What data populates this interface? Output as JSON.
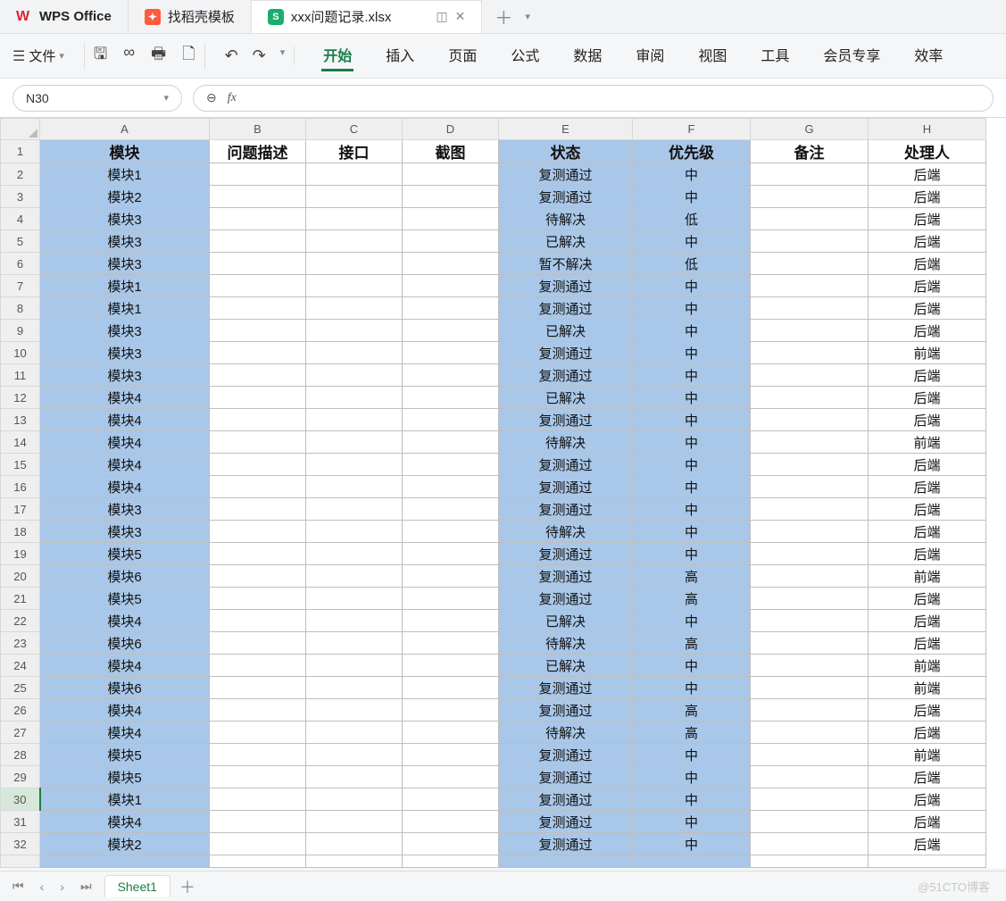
{
  "app": {
    "name": "WPS Office",
    "templates_tab": "找稻壳模板",
    "doc_tab": "xxx问题记录.xlsx"
  },
  "ribbon": {
    "file_label": "文件",
    "tabs": [
      "开始",
      "插入",
      "页面",
      "公式",
      "数据",
      "审阅",
      "视图",
      "工具",
      "会员专享",
      "效率"
    ],
    "active_tab_index": 0
  },
  "formula": {
    "namebox": "N30",
    "fx_label": "fx",
    "value": ""
  },
  "columns": [
    {
      "letter": "A",
      "width": 190
    },
    {
      "letter": "B",
      "width": 108
    },
    {
      "letter": "C",
      "width": 108
    },
    {
      "letter": "D",
      "width": 108
    },
    {
      "letter": "E",
      "width": 150
    },
    {
      "letter": "F",
      "width": 132
    },
    {
      "letter": "G",
      "width": 132
    },
    {
      "letter": "H",
      "width": 132
    }
  ],
  "headers": [
    "模块",
    "问题描述",
    "接口",
    "截图",
    "状态",
    "优先级",
    "备注",
    "处理人"
  ],
  "selected_cols": [
    0,
    4,
    5
  ],
  "rows": [
    {
      "n": 2,
      "a": "模块1",
      "e": "复测通过",
      "f": "中",
      "h": "后端"
    },
    {
      "n": 3,
      "a": "模块2",
      "e": "复测通过",
      "f": "中",
      "h": "后端"
    },
    {
      "n": 4,
      "a": "模块3",
      "e": "待解决",
      "f": "低",
      "h": "后端"
    },
    {
      "n": 5,
      "a": "模块3",
      "e": "已解决",
      "f": "中",
      "h": "后端"
    },
    {
      "n": 6,
      "a": "模块3",
      "e": "暂不解决",
      "f": "低",
      "h": "后端"
    },
    {
      "n": 7,
      "a": "模块1",
      "e": "复测通过",
      "f": "中",
      "h": "后端"
    },
    {
      "n": 8,
      "a": "模块1",
      "e": "复测通过",
      "f": "中",
      "h": "后端"
    },
    {
      "n": 9,
      "a": "模块3",
      "e": "已解决",
      "f": "中",
      "h": "后端"
    },
    {
      "n": 10,
      "a": "模块3",
      "e": "复测通过",
      "f": "中",
      "h": "前端"
    },
    {
      "n": 11,
      "a": "模块3",
      "e": "复测通过",
      "f": "中",
      "h": "后端"
    },
    {
      "n": 12,
      "a": "模块4",
      "e": "已解决",
      "f": "中",
      "h": "后端"
    },
    {
      "n": 13,
      "a": "模块4",
      "e": "复测通过",
      "f": "中",
      "h": "后端"
    },
    {
      "n": 14,
      "a": "模块4",
      "e": "待解决",
      "f": "中",
      "h": "前端"
    },
    {
      "n": 15,
      "a": "模块4",
      "e": "复测通过",
      "f": "中",
      "h": "后端"
    },
    {
      "n": 16,
      "a": "模块4",
      "e": "复测通过",
      "f": "中",
      "h": "后端"
    },
    {
      "n": 17,
      "a": "模块3",
      "e": "复测通过",
      "f": "中",
      "h": "后端"
    },
    {
      "n": 18,
      "a": "模块3",
      "e": "待解决",
      "f": "中",
      "h": "后端"
    },
    {
      "n": 19,
      "a": "模块5",
      "e": "复测通过",
      "f": "中",
      "h": "后端"
    },
    {
      "n": 20,
      "a": "模块6",
      "e": "复测通过",
      "f": "高",
      "h": "前端"
    },
    {
      "n": 21,
      "a": "模块5",
      "e": "复测通过",
      "f": "高",
      "h": "后端"
    },
    {
      "n": 22,
      "a": "模块4",
      "e": "已解决",
      "f": "中",
      "h": "后端"
    },
    {
      "n": 23,
      "a": "模块6",
      "e": "待解决",
      "f": "高",
      "h": "后端"
    },
    {
      "n": 24,
      "a": "模块4",
      "e": "已解决",
      "f": "中",
      "h": "前端"
    },
    {
      "n": 25,
      "a": "模块6",
      "e": "复测通过",
      "f": "中",
      "h": "前端"
    },
    {
      "n": 26,
      "a": "模块4",
      "e": "复测通过",
      "f": "高",
      "h": "后端"
    },
    {
      "n": 27,
      "a": "模块4",
      "e": "待解决",
      "f": "高",
      "h": "后端"
    },
    {
      "n": 28,
      "a": "模块5",
      "e": "复测通过",
      "f": "中",
      "h": "前端"
    },
    {
      "n": 29,
      "a": "模块5",
      "e": "复测通过",
      "f": "中",
      "h": "后端"
    },
    {
      "n": 30,
      "a": "模块1",
      "e": "复测通过",
      "f": "中",
      "h": "后端"
    },
    {
      "n": 31,
      "a": "模块4",
      "e": "复测通过",
      "f": "中",
      "h": "后端"
    },
    {
      "n": 32,
      "a": "模块2",
      "e": "复测通过",
      "f": "中",
      "h": "后端"
    }
  ],
  "current_row": 30,
  "sheet": {
    "name": "Sheet1"
  },
  "watermark": "@51CTO博客"
}
